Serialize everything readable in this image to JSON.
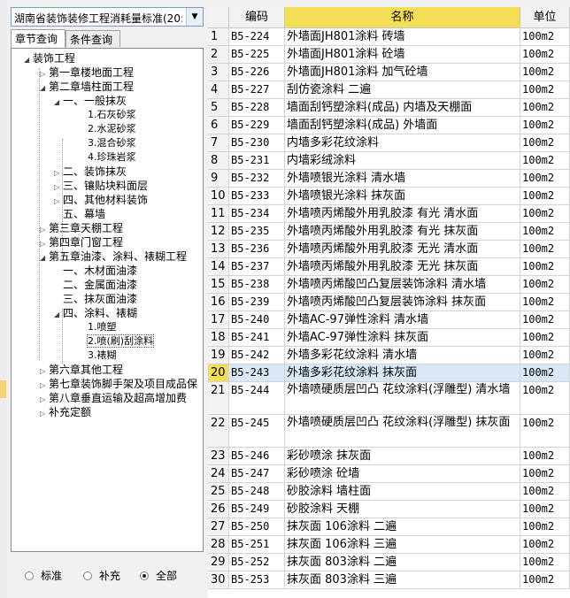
{
  "dropdown": {
    "value": "湖南省装饰装修工程消耗量标准(20:"
  },
  "tabs": [
    {
      "label": "章节查询"
    },
    {
      "label": "条件查询"
    }
  ],
  "tree": [
    {
      "label": "装饰工程",
      "level": 0,
      "toggle": "open"
    },
    {
      "label": "第一章楼地面工程",
      "level": 1,
      "toggle": "closed"
    },
    {
      "label": "第二章墙柱面工程",
      "level": 1,
      "toggle": "open"
    },
    {
      "label": "一、一般抹灰",
      "level": 2,
      "toggle": "open"
    },
    {
      "label": "1.石灰砂浆",
      "level": 3,
      "toggle": "none"
    },
    {
      "label": "2.水泥砂浆",
      "level": 3,
      "toggle": "none"
    },
    {
      "label": "3.混合砂浆",
      "level": 3,
      "toggle": "none"
    },
    {
      "label": "4.珍珠岩浆",
      "level": 3,
      "toggle": "none"
    },
    {
      "label": "二、装饰抹灰",
      "level": 2,
      "toggle": "closed"
    },
    {
      "label": "三、镶贴块料面层",
      "level": 2,
      "toggle": "closed"
    },
    {
      "label": "四、其他材料装饰",
      "level": 2,
      "toggle": "closed"
    },
    {
      "label": "五、幕墙",
      "level": 2,
      "toggle": "none"
    },
    {
      "label": "第三章天棚工程",
      "level": 1,
      "toggle": "closed"
    },
    {
      "label": "第四章门窗工程",
      "level": 1,
      "toggle": "closed"
    },
    {
      "label": "第五章油漆、涂料、裱糊工程",
      "level": 1,
      "toggle": "open"
    },
    {
      "label": "一、木材面油漆",
      "level": 2,
      "toggle": "none"
    },
    {
      "label": "二、金属面油漆",
      "level": 2,
      "toggle": "none"
    },
    {
      "label": "三、抹灰面油漆",
      "level": 2,
      "toggle": "none"
    },
    {
      "label": "四、涂料、裱糊",
      "level": 2,
      "toggle": "open"
    },
    {
      "label": "1.喷塑",
      "level": 3,
      "toggle": "none"
    },
    {
      "label": "2.喷(刷)刮涂料",
      "level": 3,
      "toggle": "none",
      "selected": true
    },
    {
      "label": "3.裱糊",
      "level": 3,
      "toggle": "none"
    },
    {
      "label": "第六章其他工程",
      "level": 1,
      "toggle": "closed"
    },
    {
      "label": "第七章装饰脚手架及项目成品保",
      "level": 1,
      "toggle": "closed"
    },
    {
      "label": "第八章垂直运输及超高增加费",
      "level": 1,
      "toggle": "closed"
    },
    {
      "label": "补充定额",
      "level": 1,
      "toggle": "closed"
    }
  ],
  "radios": [
    {
      "label": "标准",
      "checked": false
    },
    {
      "label": "补充",
      "checked": false
    },
    {
      "label": "全部",
      "checked": true
    }
  ],
  "grid": {
    "headers": {
      "code": "编码",
      "name": "名称",
      "unit": "单位"
    },
    "rows": [
      {
        "idx": "1",
        "code": "B5-224",
        "name": "外墙面JH801涂料 砖墙",
        "unit": "100m2"
      },
      {
        "idx": "2",
        "code": "B5-225",
        "name": "外墙面JH801涂料 砼墙",
        "unit": "100m2"
      },
      {
        "idx": "3",
        "code": "B5-226",
        "name": "外墙面JH801涂料 加气砼墙",
        "unit": "100m2"
      },
      {
        "idx": "4",
        "code": "B5-227",
        "name": "刮仿瓷涂料 二遍",
        "unit": "100m2"
      },
      {
        "idx": "5",
        "code": "B5-228",
        "name": "墙面刮钙塑涂料(成品) 内墙及天棚面",
        "unit": "100m2"
      },
      {
        "idx": "6",
        "code": "B5-229",
        "name": "墙面刮钙塑涂料(成品) 外墙面",
        "unit": "100m2"
      },
      {
        "idx": "7",
        "code": "B5-230",
        "name": "内墙多彩花纹涂料",
        "unit": "100m2"
      },
      {
        "idx": "8",
        "code": "B5-231",
        "name": "内墙彩绒涂料",
        "unit": "100m2"
      },
      {
        "idx": "9",
        "code": "B5-232",
        "name": "外墙喷银光涂料 清水墙",
        "unit": "100m2"
      },
      {
        "idx": "10",
        "code": "B5-233",
        "name": "外墙喷银光涂料 抹灰面",
        "unit": "100m2"
      },
      {
        "idx": "11",
        "code": "B5-234",
        "name": "外墙喷丙烯酸外用乳胶漆 有光 清水面",
        "unit": "100m2"
      },
      {
        "idx": "12",
        "code": "B5-235",
        "name": "外墙喷丙烯酸外用乳胶漆 有光 抹灰面",
        "unit": "100m2"
      },
      {
        "idx": "13",
        "code": "B5-236",
        "name": "外墙喷丙烯酸外用乳胶漆 无光 清水面",
        "unit": "100m2"
      },
      {
        "idx": "14",
        "code": "B5-237",
        "name": "外墙喷丙烯酸外用乳胶漆 无光 抹灰面",
        "unit": "100m2"
      },
      {
        "idx": "15",
        "code": "B5-238",
        "name": "外墙喷丙烯酸凹凸复层装饰涂料 清水墙",
        "unit": "100m2"
      },
      {
        "idx": "16",
        "code": "B5-239",
        "name": "外墙喷丙烯酸凹凸复层装饰涂料 抹灰面",
        "unit": "100m2"
      },
      {
        "idx": "17",
        "code": "B5-240",
        "name": "外墙AC-97弹性涂料 清水墙",
        "unit": "100m2"
      },
      {
        "idx": "18",
        "code": "B5-241",
        "name": "外墙AC-97弹性涂料 抹灰面",
        "unit": "100m2"
      },
      {
        "idx": "19",
        "code": "B5-242",
        "name": "外墙多彩花纹涂料 清水墙",
        "unit": "100m2"
      },
      {
        "idx": "20",
        "code": "B5-243",
        "name": "外墙多彩花纹涂料 抹灰面",
        "unit": "100m2",
        "selected": true
      },
      {
        "idx": "21",
        "code": "B5-244",
        "name": "外墙喷硬质层凹凸 花纹涂料(浮雕型) 清水墙",
        "unit": "100m2",
        "tall": true
      },
      {
        "idx": "22",
        "code": "B5-245",
        "name": "外墙喷硬质层凹凸 花纹涂料(浮雕型) 抹灰面",
        "unit": "100m2",
        "tall": true
      },
      {
        "idx": "23",
        "code": "B5-246",
        "name": "彩砂喷涂 抹灰面",
        "unit": "100m2"
      },
      {
        "idx": "24",
        "code": "B5-247",
        "name": "彩砂喷涂 砼墙",
        "unit": "100m2"
      },
      {
        "idx": "25",
        "code": "B5-248",
        "name": "砂胶涂料 墙柱面",
        "unit": "100m2"
      },
      {
        "idx": "26",
        "code": "B5-249",
        "name": "砂胶涂料 天棚",
        "unit": "100m2"
      },
      {
        "idx": "27",
        "code": "B5-250",
        "name": "抹灰面 106涂料 二遍",
        "unit": "100m2"
      },
      {
        "idx": "28",
        "code": "B5-251",
        "name": "抹灰面 106涂料 三遍",
        "unit": "100m2"
      },
      {
        "idx": "29",
        "code": "B5-252",
        "name": "抹灰面 803涂料 二遍",
        "unit": "100m2"
      },
      {
        "idx": "30",
        "code": "B5-253",
        "name": "抹灰面 803涂料 三遍",
        "unit": "100m2"
      }
    ]
  }
}
